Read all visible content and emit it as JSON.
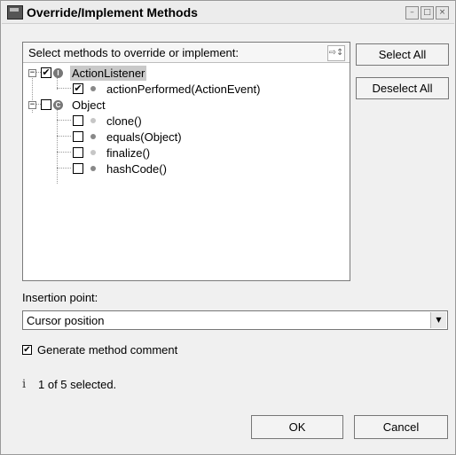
{
  "window": {
    "title": "Override/Implement Methods",
    "controls": [
      "–",
      "□",
      "×"
    ]
  },
  "tree": {
    "header_label": "Select methods to override or implement:",
    "sort_icon": "sort-icon",
    "nodes": [
      {
        "label": "ActionListener",
        "checked": true,
        "kind": "interface",
        "icon_letter": "I",
        "expanded": true,
        "selected": true,
        "children": [
          {
            "label": "actionPerformed(ActionEvent)",
            "checked": true,
            "icon": "public-method-icon"
          }
        ]
      },
      {
        "label": "Object",
        "checked": false,
        "kind": "class",
        "icon_letter": "C",
        "expanded": true,
        "selected": false,
        "children": [
          {
            "label": "clone()",
            "checked": false,
            "icon": "protected-method-icon"
          },
          {
            "label": "equals(Object)",
            "checked": false,
            "icon": "public-method-icon"
          },
          {
            "label": "finalize()",
            "checked": false,
            "icon": "protected-method-icon"
          },
          {
            "label": "hashCode()",
            "checked": false,
            "icon": "public-method-icon"
          }
        ]
      }
    ]
  },
  "buttons": {
    "select_all": "Select All",
    "deselect_all": "Deselect All",
    "ok": "OK",
    "cancel": "Cancel"
  },
  "insertion": {
    "label": "Insertion point:",
    "value": "Cursor position"
  },
  "options": {
    "generate_comment_label": "Generate method comment",
    "generate_comment_checked": true
  },
  "status": {
    "icon": "info-icon",
    "text": "1 of 5 selected."
  }
}
